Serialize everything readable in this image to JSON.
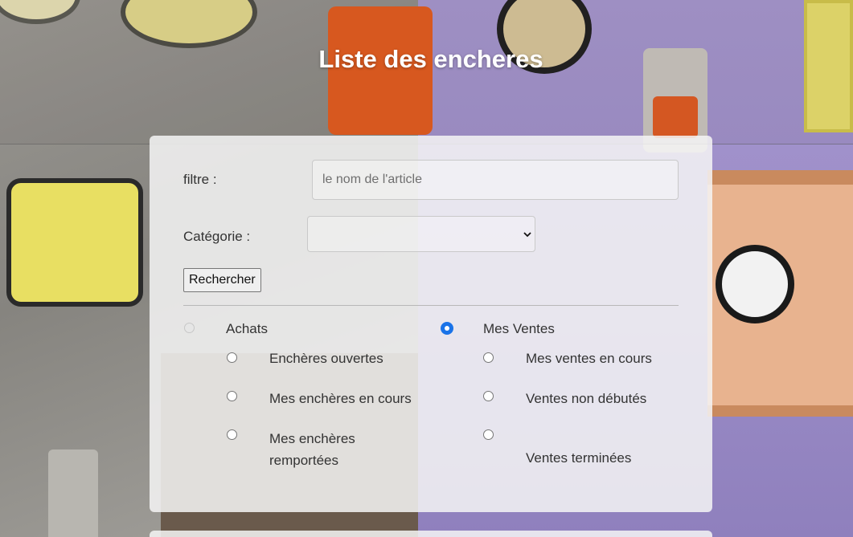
{
  "page": {
    "title": "Liste des encheres"
  },
  "filter": {
    "label": "filtre :",
    "placeholder": "le nom de l'article"
  },
  "category": {
    "label": "Catégorie :",
    "selected": ""
  },
  "search_button": {
    "label": "Rechercher"
  },
  "mode": {
    "achats": {
      "label": "Achats",
      "checked": false,
      "options": [
        "Enchères ouvertes",
        "Mes enchères en cours",
        "Mes enchères remportées"
      ]
    },
    "ventes": {
      "label": "Mes Ventes",
      "checked": true,
      "options": [
        "Mes ventes en cours",
        "Ventes non débutés",
        "Ventes terminées"
      ]
    }
  },
  "colors": {
    "accent": "#1a73e8",
    "title": "#ffffff",
    "panel": "#f5f5f5"
  }
}
